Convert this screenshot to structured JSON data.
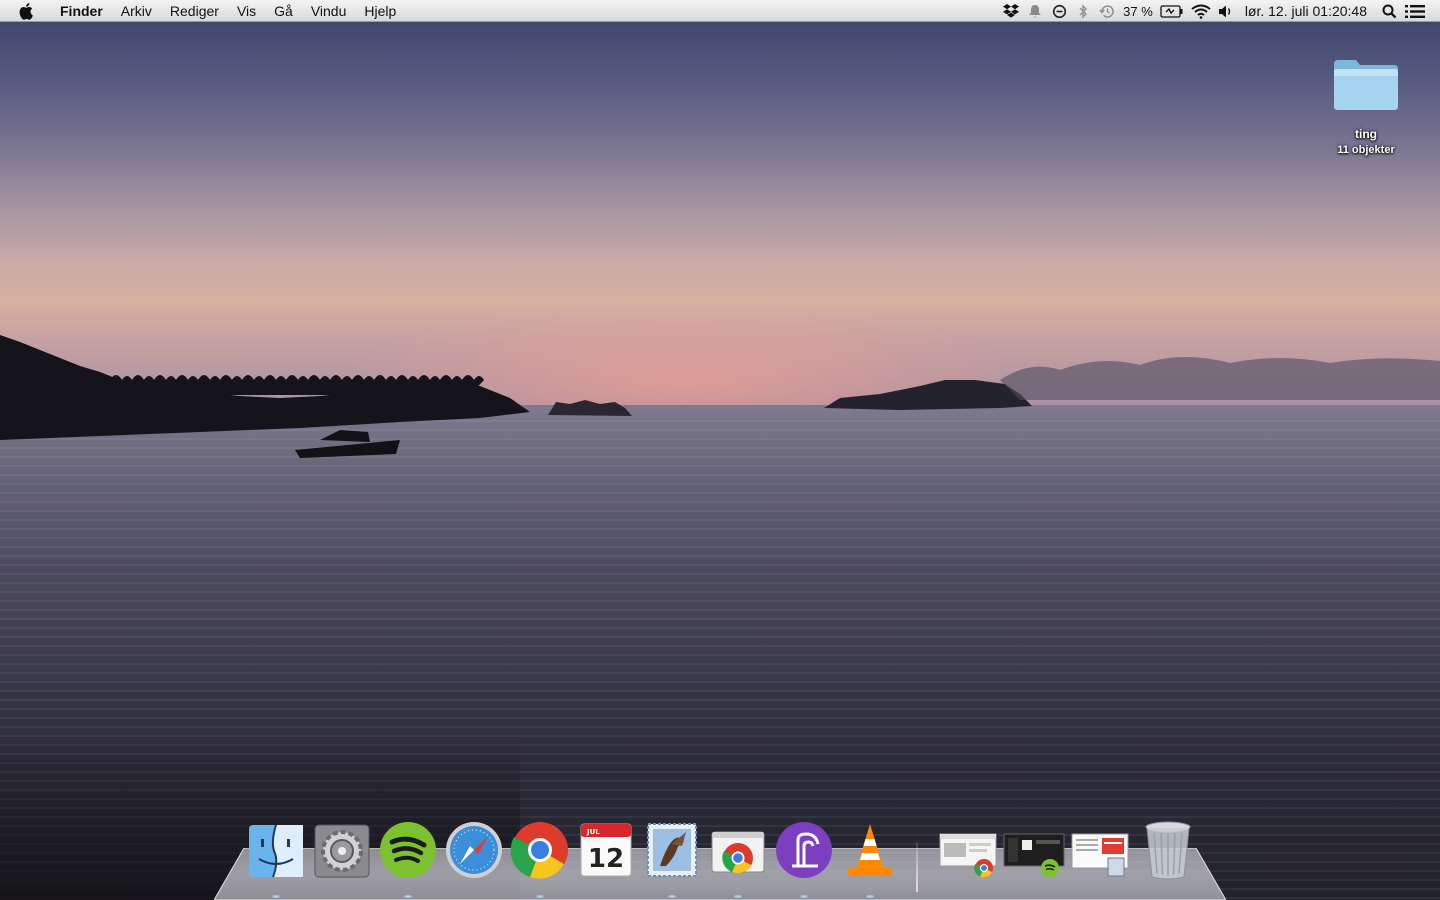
{
  "menubar": {
    "apple_icon": "apple-icon",
    "app_name": "Finder",
    "items": [
      "Arkiv",
      "Rediger",
      "Vis",
      "Gå",
      "Vindu",
      "Hjelp"
    ],
    "status": {
      "battery_percent": "37 %",
      "clock": "lør. 12. juli  01:20:48",
      "icons": [
        "dropbox-icon",
        "notification-icon",
        "sync-icon",
        "bluetooth-icon",
        "time-machine-icon",
        "battery-icon",
        "wifi-icon",
        "volume-icon",
        "spotlight-icon",
        "notification-center-icon"
      ]
    }
  },
  "desktop": {
    "folder": {
      "name": "ting",
      "info": "11 objekter"
    }
  },
  "dock": {
    "apps": [
      "finder",
      "system-preferences",
      "spotify",
      "safari",
      "chrome",
      "calendar",
      "mail",
      "chrome-app-launcher",
      "bittorrent",
      "vlc"
    ],
    "calendar": {
      "month": "JUL",
      "day": "12"
    },
    "minimized": [
      "chrome-window",
      "spotify-window",
      "preview-window"
    ],
    "trash": "trash"
  },
  "colors": {
    "menubar": "#e6e6e6",
    "folder": "#8ec3e6",
    "spotify": "#7bc130",
    "bittorrent": "#7b3fbf",
    "vlc": "#ff8800"
  }
}
